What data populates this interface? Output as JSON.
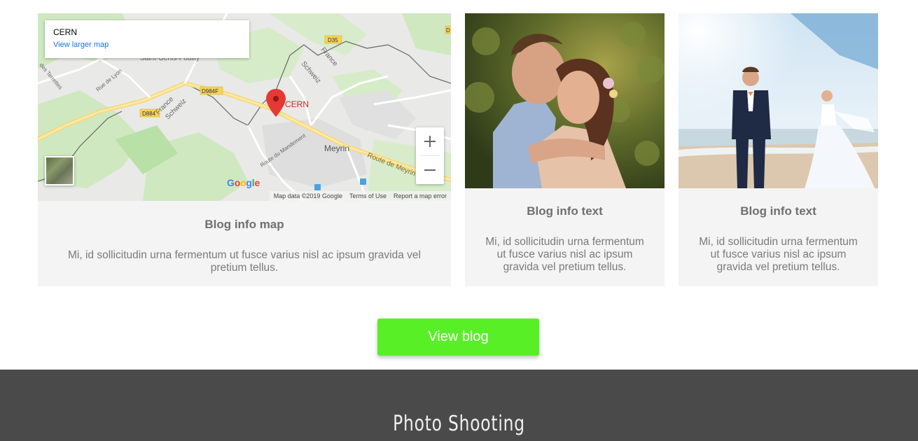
{
  "map_card": {
    "info_title": "CERN",
    "info_link": "View larger map",
    "pin_label": "CERN",
    "place_labels": {
      "meyrin": "Meyrin",
      "route_meyrin": "Route de Meyrin",
      "route_mandement": "Route du Mandement",
      "france_schweiz_1": "France",
      "schweiz_1": "Schweiz",
      "france_2": "France",
      "schweiz_2": "Schweiz",
      "saint_genis": "Saint-Genis-Pouilly",
      "rue_lyon": "Rue de Lyon",
      "terrettes": "des Terrettes",
      "road_d35": "D35",
      "road_d984f": "D984F",
      "road_d884": "D884",
      "road_d": "D"
    },
    "google_logo": "Google",
    "footer_mapdata": "Map data ©2019 Google",
    "footer_terms": "Terms of Use",
    "footer_report": "Report a map error",
    "title": "Blog info map",
    "text": "Mi, id sollicitudin urna fermentum ut fusce varius nisl ac ipsum gravida vel pretium tellus."
  },
  "card_1": {
    "title": "Blog info text",
    "text": "Mi, id sollicitudin urna fermentum ut fusce varius nisl ac ipsum gravida vel pretium tellus."
  },
  "card_2": {
    "title": "Blog info text",
    "text": "Mi, id sollicitudin urna fermentum ut fusce varius nisl ac ipsum gravida vel pretium tellus."
  },
  "view_blog_label": "View blog",
  "footer": {
    "title": "Photo Shooting"
  },
  "colors": {
    "accent": "#59ef27",
    "footer_bg": "#4a4a4a",
    "card_bg": "#f4f4f4",
    "map_pin": "#e53935"
  }
}
